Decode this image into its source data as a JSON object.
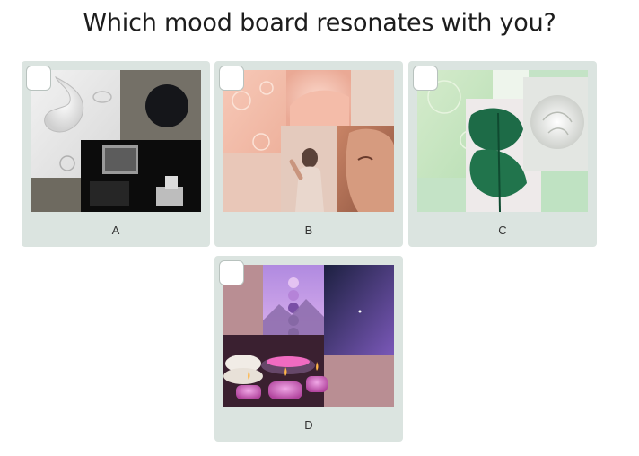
{
  "question": "Which mood board resonates with you?",
  "options": [
    {
      "label": "A",
      "selected": false
    },
    {
      "label": "B",
      "selected": false
    },
    {
      "label": "C",
      "selected": false
    },
    {
      "label": "D",
      "selected": false
    }
  ]
}
